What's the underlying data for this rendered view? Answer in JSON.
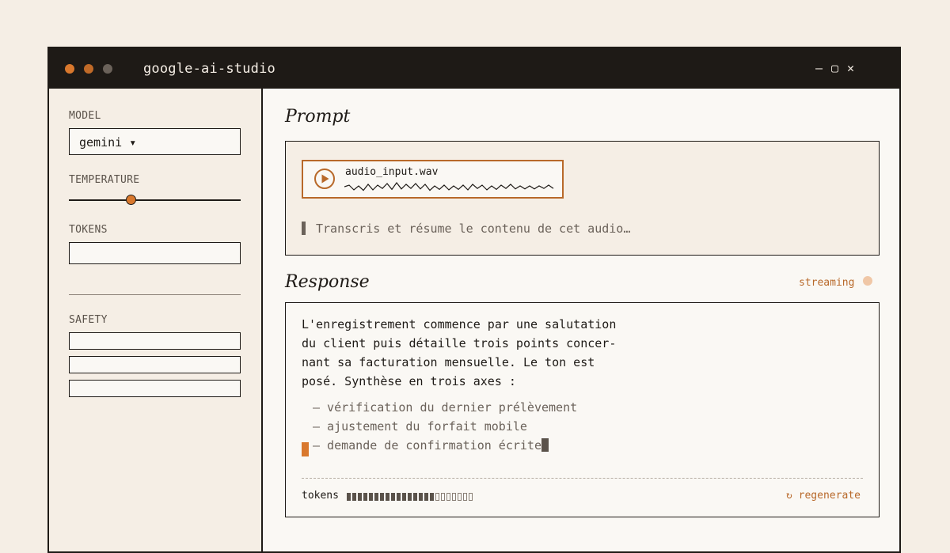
{
  "window": {
    "title": "google-ai-studio",
    "controls": {
      "minimize": "—",
      "maximize": "▢",
      "close": "✕"
    },
    "dot_colors": [
      "#d9782d",
      "#c06a28",
      "#6b625a"
    ]
  },
  "sidebar": {
    "model_label": "MODEL",
    "model_value": "gemini ▾",
    "temperature_label": "TEMPERATURE",
    "temperature_level": 0.36,
    "tokens_label": "TOKENS",
    "tokens_value": "",
    "safety_label": "SAFETY",
    "safety_fields": [
      "",
      "",
      ""
    ]
  },
  "prompt": {
    "heading": "Prompt",
    "audio_file": "audio_input.wav",
    "text": "Transcris et résume le contenu de cet audio…"
  },
  "response": {
    "heading": "Response",
    "status": "streaming",
    "lines": [
      "L'enregistrement commence par une salutation",
      "du client puis détaille trois points concer-",
      "nant sa facturation mensuelle. Le ton est",
      "posé. Synthèse en trois axes :"
    ],
    "bullets": [
      "— vérification du dernier prélèvement",
      "— ajustement du forfait mobile",
      "— demande de confirmation écrite"
    ],
    "tokens_label": "tokens",
    "tokens_filled": 16,
    "tokens_total": 23,
    "regenerate_label": "↻ regenerate"
  },
  "colors": {
    "accent": "#d9782d",
    "accent_dark": "#b8692a",
    "ink": "#1e1a16",
    "paper": "#f5eee5"
  }
}
